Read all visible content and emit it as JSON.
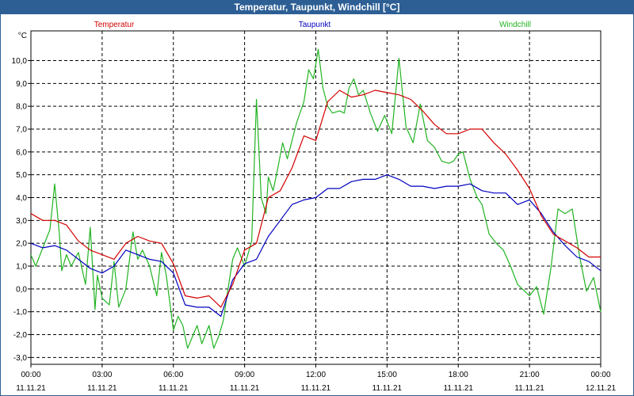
{
  "window": {
    "title": "Temperatur, Taupunkt, Windchill [°C]"
  },
  "chart_data": {
    "type": "line",
    "title": "Temperatur, Taupunkt, Windchill [°C]",
    "ylabel": "°C",
    "xlabel": "",
    "ylim": [
      -3.3,
      11.3
    ],
    "xlim": [
      0,
      24
    ],
    "grid": true,
    "legend_placement": "top",
    "y_ticks": [
      "-3,0",
      "-2,0",
      "-1,0",
      "0,0",
      "1,0",
      "2,0",
      "3,0",
      "4,0",
      "5,0",
      "6,0",
      "7,0",
      "8,0",
      "9,0",
      "10,0"
    ],
    "x_ticks": [
      {
        "time": "00:00",
        "date": "11.11.21"
      },
      {
        "time": "03:00",
        "date": "11.11.21"
      },
      {
        "time": "06:00",
        "date": "11.11.21"
      },
      {
        "time": "09:00",
        "date": "11.11.21"
      },
      {
        "time": "12:00",
        "date": "11.11.21"
      },
      {
        "time": "15:00",
        "date": "11.11.21"
      },
      {
        "time": "18:00",
        "date": "11.11.21"
      },
      {
        "time": "21:00",
        "date": "11.11.21"
      },
      {
        "time": "00:00",
        "date": "12.11.21"
      }
    ],
    "series": [
      {
        "name": "Temperatur",
        "color": "#d40000",
        "x": [
          0,
          0.5,
          1,
          1.5,
          2,
          2.5,
          3,
          3.5,
          4,
          4.5,
          5,
          5.5,
          6,
          6.5,
          7,
          7.5,
          8,
          8.5,
          9,
          9.5,
          10,
          10.5,
          11,
          11.5,
          12,
          12.5,
          13,
          13.5,
          14,
          14.5,
          15,
          15.5,
          16,
          16.5,
          17,
          17.5,
          18,
          18.5,
          19,
          19.5,
          20,
          20.5,
          21,
          21.5,
          22,
          22.5,
          23,
          23.5,
          24
        ],
        "values": [
          3.3,
          3.0,
          3.0,
          2.8,
          2.1,
          1.7,
          1.5,
          1.3,
          2.0,
          2.3,
          2.1,
          2.0,
          1.1,
          -0.3,
          -0.4,
          -0.3,
          -0.8,
          0.2,
          1.7,
          2.0,
          4.0,
          4.3,
          5.3,
          6.7,
          6.5,
          8.2,
          8.7,
          8.4,
          8.5,
          8.7,
          8.6,
          8.5,
          8.3,
          7.8,
          7.2,
          6.8,
          6.8,
          7.0,
          7.0,
          6.4,
          5.9,
          5.2,
          4.4,
          3.2,
          2.4,
          2.1,
          1.8,
          1.4,
          1.4
        ]
      },
      {
        "name": "Taupunkt",
        "color": "#0000c0",
        "x": [
          0,
          0.5,
          1,
          1.5,
          2,
          2.5,
          3,
          3.5,
          4,
          4.5,
          5,
          5.5,
          6,
          6.5,
          7,
          7.5,
          8,
          8.5,
          9,
          9.5,
          10,
          10.5,
          11,
          11.5,
          12,
          12.5,
          13,
          13.5,
          14,
          14.5,
          15,
          15.5,
          16,
          16.5,
          17,
          17.5,
          18,
          18.5,
          19,
          19.5,
          20,
          20.5,
          21,
          21.5,
          22,
          22.5,
          23,
          23.5,
          24
        ],
        "values": [
          2.0,
          1.8,
          1.9,
          1.7,
          1.3,
          0.9,
          0.7,
          1.0,
          1.7,
          1.5,
          1.3,
          1.2,
          0.7,
          -0.7,
          -0.8,
          -0.8,
          -1.2,
          0.4,
          1.1,
          1.3,
          2.3,
          3.0,
          3.7,
          3.9,
          4.0,
          4.4,
          4.4,
          4.7,
          4.8,
          4.8,
          5.0,
          4.8,
          4.5,
          4.5,
          4.4,
          4.5,
          4.5,
          4.6,
          4.3,
          4.2,
          4.2,
          3.7,
          3.9,
          3.3,
          2.5,
          1.9,
          1.4,
          1.2,
          0.8
        ]
      },
      {
        "name": "Windchill",
        "color": "#22b422",
        "x": [
          0,
          0.2,
          0.5,
          0.8,
          1,
          1.2,
          1.3,
          1.5,
          1.7,
          2,
          2.3,
          2.5,
          2.7,
          2.8,
          3,
          3.3,
          3.5,
          3.7,
          4,
          4.3,
          4.5,
          4.7,
          5,
          5.3,
          5.5,
          5.7,
          6,
          6.2,
          6.4,
          6.6,
          6.8,
          7,
          7.2,
          7.5,
          7.7,
          7.9,
          8.1,
          8.3,
          8.5,
          8.7,
          9,
          9.3,
          9.5,
          9.7,
          9.9,
          10,
          10.2,
          10.4,
          10.6,
          10.8,
          11,
          11.2,
          11.5,
          11.7,
          11.9,
          12.1,
          12.3,
          12.5,
          12.7,
          13,
          13.2,
          13.4,
          13.6,
          13.8,
          14,
          14.3,
          14.6,
          14.9,
          15.2,
          15.5,
          15.8,
          16.1,
          16.4,
          16.7,
          17,
          17.3,
          17.6,
          17.8,
          18,
          18.2,
          18.5,
          18.8,
          19,
          19.3,
          19.6,
          19.9,
          20.2,
          20.5,
          20.8,
          21,
          21.3,
          21.6,
          21.9,
          22.2,
          22.5,
          22.8,
          23.1,
          23.4,
          23.7,
          24
        ],
        "values": [
          1.5,
          1.0,
          1.8,
          2.6,
          4.6,
          2.4,
          0.8,
          1.5,
          1.0,
          1.6,
          0.2,
          2.7,
          -0.9,
          0.6,
          -0.4,
          -0.7,
          1.2,
          -0.8,
          0.0,
          2.5,
          1.3,
          1.7,
          1.0,
          -0.3,
          1.6,
          0.6,
          -1.8,
          -1.2,
          -1.6,
          -2.6,
          -2.1,
          -1.6,
          -2.4,
          -1.6,
          -2.6,
          -2.1,
          -1.4,
          0.0,
          1.3,
          1.8,
          1.0,
          2.1,
          8.3,
          4.0,
          3.3,
          4.9,
          4.3,
          5.3,
          6.4,
          5.7,
          6.5,
          7.3,
          8.2,
          9.6,
          9.2,
          10.5,
          8.8,
          8.0,
          7.7,
          7.8,
          7.7,
          8.8,
          9.2,
          8.5,
          8.7,
          7.7,
          6.9,
          7.6,
          6.8,
          10.1,
          7.1,
          6.4,
          8.1,
          6.5,
          6.2,
          5.6,
          5.5,
          5.6,
          5.9,
          6.0,
          4.8,
          4.0,
          3.7,
          2.4,
          2.0,
          1.7,
          1.0,
          0.2,
          -0.1,
          -0.3,
          0.1,
          -1.1,
          0.9,
          3.5,
          3.3,
          3.5,
          1.5,
          -0.1,
          0.5,
          -1.0
        ]
      }
    ]
  }
}
